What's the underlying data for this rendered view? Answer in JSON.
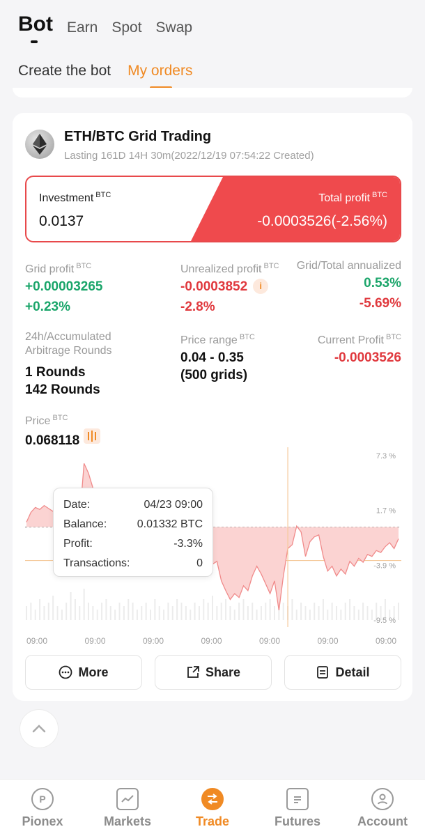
{
  "top_tabs": [
    {
      "label": "Bot",
      "active": true
    },
    {
      "label": "Earn"
    },
    {
      "label": "Spot"
    },
    {
      "label": "Swap"
    }
  ],
  "sub_tabs": [
    {
      "label": "Create the bot"
    },
    {
      "label": "My orders",
      "active": true
    }
  ],
  "bot": {
    "coin_icon": "eth-icon",
    "title": "ETH/BTC Grid Trading",
    "subtitle": "Lasting 161D 14H 30m(2022/12/19 07:54:22 Created)",
    "investment_label": "Investment",
    "investment_unit": "BTC",
    "investment_value": "0.0137",
    "total_profit_label": "Total profit",
    "total_profit_unit": "BTC",
    "total_profit_value": "-0.0003526(-2.56%)"
  },
  "stats": {
    "grid_profit_label": "Grid profit",
    "grid_profit_unit": "BTC",
    "grid_profit_value": "+0.00003265",
    "grid_profit_pct": "+0.23%",
    "unrealized_label": "Unrealized profit",
    "unrealized_unit": "BTC",
    "unrealized_value": "-0.0003852",
    "unrealized_pct": "-2.8%",
    "annualized_label": "Grid/Total annualized",
    "annualized_grid": "0.53%",
    "annualized_total": "-5.69%",
    "rounds_label_1": "24h/Accumulated",
    "rounds_label_2": "Arbitrage Rounds",
    "rounds_24h": "1 Rounds",
    "rounds_total": "142 Rounds",
    "price_range_label": "Price range",
    "price_range_unit": "BTC",
    "price_range_value": "0.04 - 0.35",
    "price_range_grids": "(500 grids)",
    "current_profit_label": "Current Profit",
    "current_profit_unit": "BTC",
    "current_profit_value": "-0.0003526",
    "price_label": "Price",
    "price_unit": "BTC",
    "price_value": "0.068118",
    "info_icon": "info-icon",
    "kline_icon": "candlestick-icon"
  },
  "chart_data": {
    "type": "area",
    "y_tick_labels": [
      "7.3 %",
      "1.7 %",
      "-3.9 %",
      "-9.5 %"
    ],
    "y_ticks": [
      7.3,
      1.7,
      -3.9,
      -9.5
    ],
    "ylim": [
      -9.5,
      7.3
    ],
    "x_tick_labels": [
      "09:00",
      "09:00",
      "09:00",
      "09:00",
      "09:00",
      "09:00",
      "09:00"
    ],
    "baseline": 0,
    "current_level": 0,
    "crosshair_index": 59,
    "series": [
      {
        "values": [
          0.5,
          1.5,
          2.0,
          1.8,
          2.2,
          1.9,
          1.6,
          1.4,
          1.2,
          1.0,
          1.3,
          1.1,
          0.8,
          6.5,
          5.5,
          4.0,
          2.8,
          -0.3,
          -0.2,
          0.3,
          0.5,
          0.8,
          0.6,
          0.2,
          0.4,
          0.0,
          -0.2,
          0.6,
          0.4,
          -0.1,
          0.3,
          0.8,
          1.1,
          1.5,
          -0.3,
          -0.1,
          0.2,
          -0.1,
          0.6,
          1.0,
          0.8,
          -0.8,
          -3.8,
          -3.5,
          -5.5,
          -6.5,
          -7.4,
          -6.8,
          -7.2,
          -6.0,
          -6.5,
          -5.0,
          -4.0,
          -4.8,
          -5.8,
          -6.8,
          -5.5,
          -8.5,
          -5.0,
          -2.2,
          -1.8,
          0.1,
          -0.5,
          -3.0,
          -1.5,
          -1.0,
          -0.8,
          -3.0,
          -4.5,
          -4.0,
          -5.0,
          -4.3,
          -4.8,
          -3.5,
          -4.0,
          -3.2,
          -3.6,
          -2.8,
          -3.0,
          -2.4,
          -2.6,
          -2.0,
          -1.6,
          -2.2,
          -1.2
        ]
      }
    ],
    "volume_bars": [
      0.4,
      0.5,
      0.3,
      0.6,
      0.4,
      0.5,
      0.7,
      0.4,
      0.3,
      0.5,
      0.8,
      0.6,
      0.4,
      0.9,
      0.5,
      0.4,
      0.3,
      0.5,
      0.6,
      0.4,
      0.3,
      0.5,
      0.4,
      0.6,
      0.5,
      0.3,
      0.4,
      0.5,
      0.3,
      0.6,
      0.4,
      0.3,
      0.5,
      0.4,
      0.6,
      0.5,
      0.4,
      0.3,
      0.5,
      0.4,
      0.6,
      0.5,
      0.7,
      0.4,
      0.5,
      0.6,
      0.4,
      0.3,
      0.5,
      0.6,
      0.4,
      0.5,
      0.3,
      0.4,
      0.5,
      0.6,
      0.4,
      0.8,
      0.5,
      0.4,
      0.6,
      0.3,
      0.5,
      0.4,
      0.3,
      0.5,
      0.4,
      0.6,
      0.3,
      0.5,
      0.4,
      0.3,
      0.5,
      0.6,
      0.4,
      0.3,
      0.5,
      0.4,
      0.3,
      0.5,
      0.4,
      0.6,
      0.3,
      0.4,
      0.5
    ]
  },
  "tooltip": {
    "date_label": "Date:",
    "date_value": "04/23 09:00",
    "balance_label": "Balance:",
    "balance_value": "0.01332 BTC",
    "profit_label": "Profit:",
    "profit_value": "-3.3%",
    "transactions_label": "Transactions:",
    "transactions_value": "0"
  },
  "actions": {
    "more_label": "More",
    "share_label": "Share",
    "detail_label": "Detail"
  },
  "bottom_nav": [
    {
      "label": "Pionex",
      "icon": "pionex-icon"
    },
    {
      "label": "Markets",
      "icon": "markets-icon"
    },
    {
      "label": "Trade",
      "icon": "trade-icon",
      "active": true
    },
    {
      "label": "Futures",
      "icon": "futures-icon"
    },
    {
      "label": "Account",
      "icon": "account-icon"
    }
  ],
  "colors": {
    "accent": "#f08a24",
    "profit_green": "#1aa56a",
    "loss_red": "#e0393e",
    "total_profit_bg": "#ef4a4d"
  }
}
